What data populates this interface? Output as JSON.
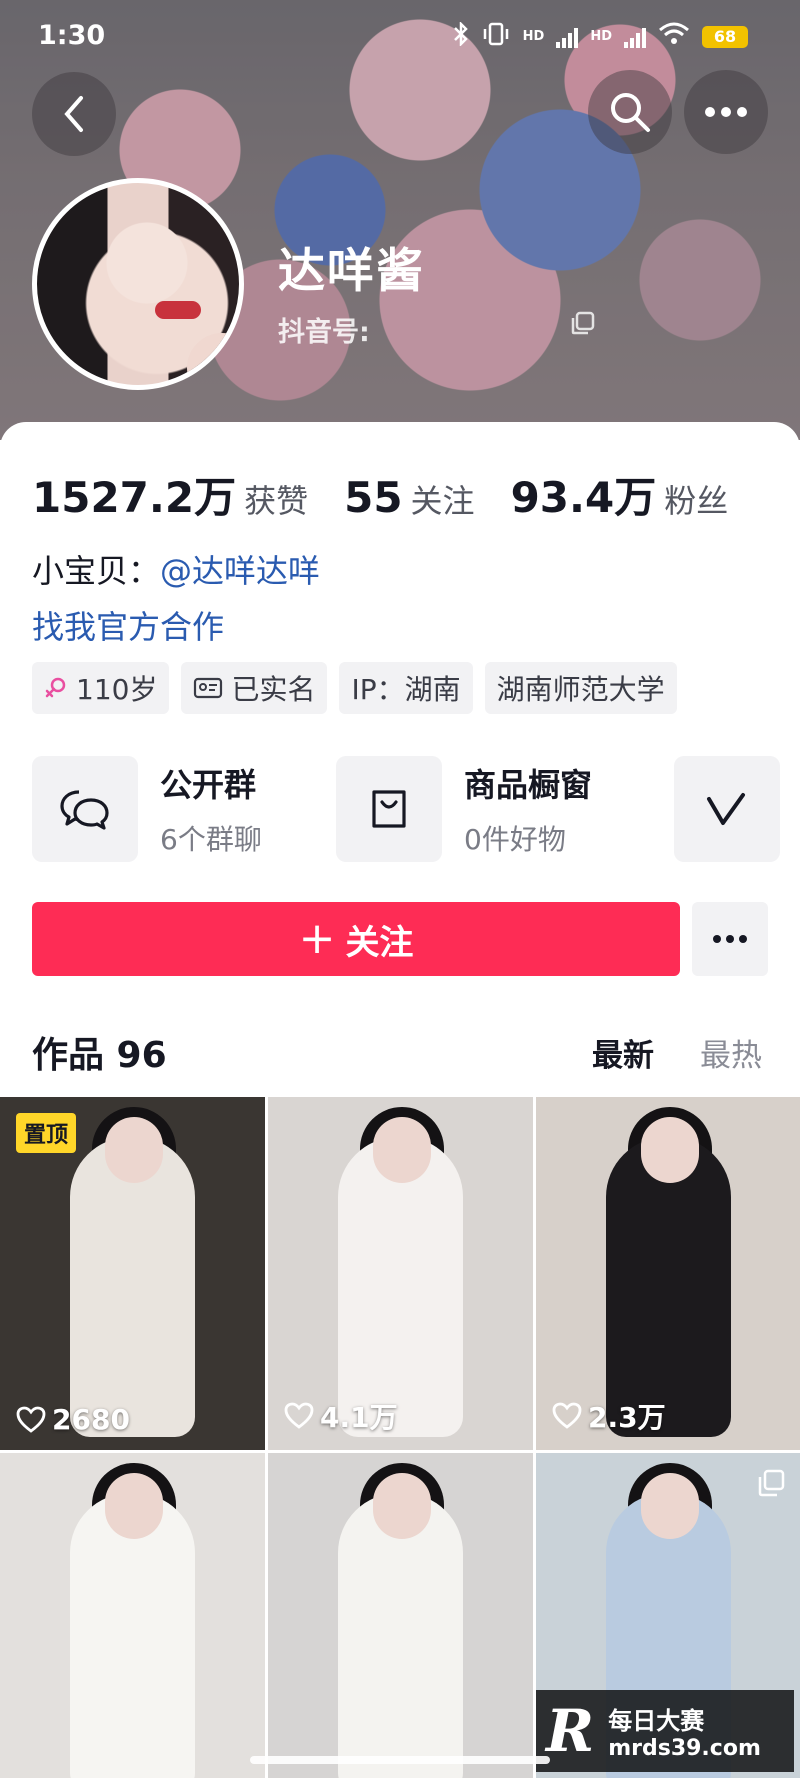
{
  "status_bar": {
    "time": "1:30",
    "network_1": "HD",
    "network_2": "HD",
    "battery": "68"
  },
  "profile": {
    "nickname": "达咩酱",
    "douyin_id_label": "抖音号:"
  },
  "stats": [
    {
      "value": "1527.2万",
      "label": "获赞"
    },
    {
      "value": "55",
      "label": "关注"
    },
    {
      "value": "93.4万",
      "label": "粉丝"
    }
  ],
  "bio": {
    "prefix": "小宝贝：",
    "mention": "@达咩达咩",
    "line2": "找我官方合作"
  },
  "tags": [
    {
      "icon": "female-icon",
      "text": "110岁"
    },
    {
      "icon": "id-card-icon",
      "text": "已实名"
    },
    {
      "icon": "",
      "text": "IP：湖南"
    },
    {
      "icon": "",
      "text": "湖南师范大学"
    }
  ],
  "features": [
    {
      "icon": "chat-group-icon",
      "title": "公开群",
      "subtitle": "6个群聊"
    },
    {
      "icon": "shopping-bag-icon",
      "title": "商品橱窗",
      "subtitle": "0件好物"
    },
    {
      "icon": "v-logo-icon",
      "title": "",
      "subtitle": ""
    }
  ],
  "follow": {
    "label": "关注"
  },
  "works": {
    "title": "作品 96",
    "sort_new": "最新",
    "sort_hot": "最热"
  },
  "videos": [
    {
      "likes": "2680",
      "pinned": "置顶",
      "bg": "#3a3632",
      "outfit": "#e9e4de"
    },
    {
      "likes": "4.1万",
      "pinned": "",
      "bg": "#d9d5d2",
      "outfit": "#f4f1ef"
    },
    {
      "likes": "2.3万",
      "pinned": "",
      "bg": "#d7d0ca",
      "outfit": "#1c1a1d"
    },
    {
      "likes": "",
      "pinned": "",
      "bg": "#e3e0dd",
      "outfit": "#f6f5f2"
    },
    {
      "likes": "",
      "pinned": "",
      "bg": "#d6d4d3",
      "outfit": "#f4f3f0"
    },
    {
      "likes": "",
      "pinned": "",
      "bg": "#c9d2d8",
      "outfit": "#b9cbe0"
    }
  ],
  "watermark": {
    "logo": "R",
    "title": "每日大赛",
    "url": "mrds39.com"
  },
  "colors": {
    "accent": "#fe2c55",
    "link": "#2a5bb0",
    "pin_badge": "#ffd629"
  }
}
